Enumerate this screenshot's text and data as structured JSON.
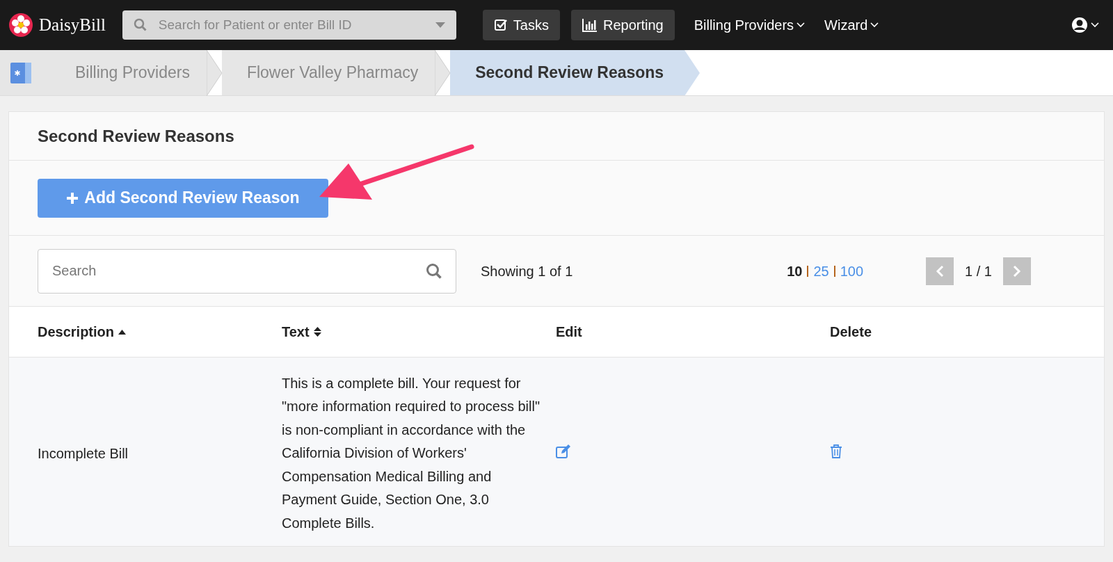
{
  "navbar": {
    "logo": "DaisyBill",
    "search": {
      "placeholder": "Search for Patient or enter Bill ID"
    },
    "buttons": [
      {
        "label": "Tasks",
        "kind": "tasks"
      },
      {
        "label": "Reporting",
        "kind": "reporting"
      }
    ],
    "menus": [
      {
        "label": "Billing Providers"
      },
      {
        "label": "Wizard"
      }
    ]
  },
  "breadcrumb": [
    {
      "label": "Billing Providers",
      "selected": false
    },
    {
      "label": "Flower Valley Pharmacy",
      "selected": false
    },
    {
      "label": "Second Review Reasons",
      "selected": true
    }
  ],
  "panel": {
    "title": "Second Review Reasons",
    "add_button": "Add Second Review Reason",
    "search": {
      "placeholder": "Search"
    },
    "showing": "Showing 1 of 1",
    "page_sizes": [
      {
        "label": "10",
        "selected": true
      },
      {
        "label": "25",
        "selected": false
      },
      {
        "label": "100",
        "selected": false
      }
    ],
    "pager": {
      "label": "1 / 1",
      "prev_disabled": true,
      "next_disabled": true
    },
    "table": {
      "columns": [
        {
          "label": "Description",
          "kind": "sorted"
        },
        {
          "label": "Text",
          "kind": "sortable"
        },
        {
          "label": "Edit",
          "kind": "plain"
        },
        {
          "label": "Delete",
          "kind": "plain"
        }
      ],
      "rows": [
        {
          "description": "Incomplete Bill",
          "text": "This is a complete bill. Your request for \"more information required to process bill\" is non-compliant in accordance with the California Division of Workers' Compensation Medical Billing and Payment Guide, Section One, 3.0 Complete Bills."
        }
      ]
    }
  }
}
